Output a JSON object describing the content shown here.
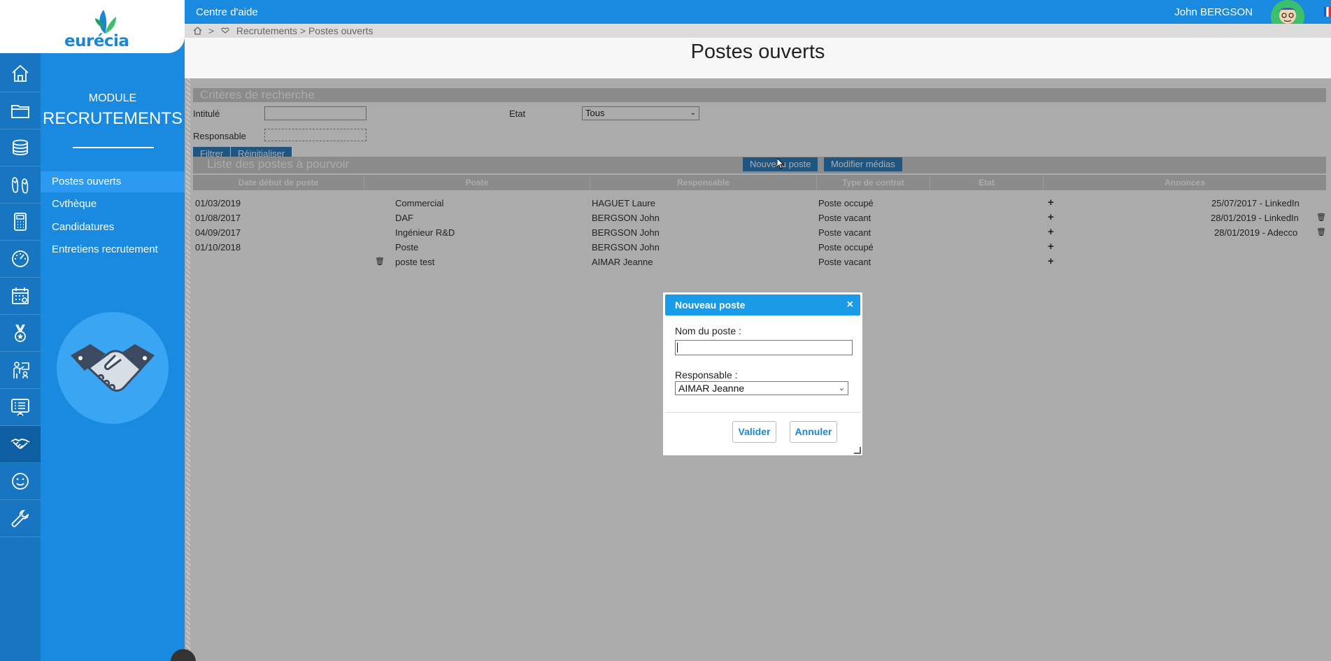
{
  "app": {
    "logo_text": "eurécia",
    "help_label": "Centre d'aide",
    "user_name": "John  BERGSON"
  },
  "colors": {
    "primary": "#1a8ae0",
    "rail": "#1775c2",
    "dialog_header": "#1a9be8"
  },
  "rail_icons": [
    "home-icon",
    "folder-icon",
    "coins-icon",
    "sandals-icon",
    "calculator-icon",
    "speedometer-icon",
    "calendar-icon",
    "medal-icon",
    "person-presentation-icon",
    "checklist-board-icon",
    "handshake-icon",
    "smiley-icon",
    "wrench-icon"
  ],
  "module": {
    "label": "MODULE",
    "name": "RECRUTEMENTS",
    "nav": [
      "Postes ouverts",
      "Cvthèque",
      "Candidatures",
      "Entretiens recrutement"
    ]
  },
  "breadcrumb": {
    "home_sep": ">",
    "path": "Recrutements > Postes ouverts"
  },
  "page_title": "Postes ouverts",
  "criteria": {
    "heading": "Critères de recherche",
    "intitule_label": "Intitulé",
    "etat_label": "Etat",
    "etat_value": "Tous",
    "responsable_label": "Responsable",
    "filter_btn": "Filtrer",
    "reset_btn": "Réinitialiser"
  },
  "list": {
    "heading": "Liste des postes à pourvoir",
    "new_btn": "Nouveau poste",
    "media_btn": "Modifier médias",
    "columns": [
      "Date début de poste",
      "Poste",
      "Responsable",
      "Type de contrat",
      "Etat",
      "Annonces"
    ],
    "rows": [
      {
        "date": "01/03/2019",
        "poste": "Commercial",
        "resp": "HAGUET Laure",
        "type": "Poste occupé",
        "annonce": "25/07/2017 - LinkedIn"
      },
      {
        "date": "01/08/2017",
        "poste": "DAF",
        "resp": "BERGSON John",
        "type": "Poste vacant",
        "annonce": "28/01/2019 - LinkedIn"
      },
      {
        "date": "04/09/2017",
        "poste": "Ingénieur R&D",
        "resp": "BERGSON John",
        "type": "Poste vacant",
        "annonce": "28/01/2019 - Adecco"
      },
      {
        "date": "01/10/2018",
        "poste": "Poste",
        "resp": "BERGSON John",
        "type": "Poste occupé",
        "annonce": ""
      },
      {
        "date": "",
        "poste": "poste test",
        "resp": "AIMAR Jeanne",
        "type": "Poste vacant",
        "annonce": ""
      }
    ]
  },
  "dialog": {
    "title": "Nouveau poste",
    "close": "×",
    "name_label": "Nom du poste :",
    "name_value": "",
    "resp_label": "Responsable :",
    "resp_value": "AIMAR Jeanne",
    "ok_btn": "Valider",
    "cancel_btn": "Annuler"
  }
}
